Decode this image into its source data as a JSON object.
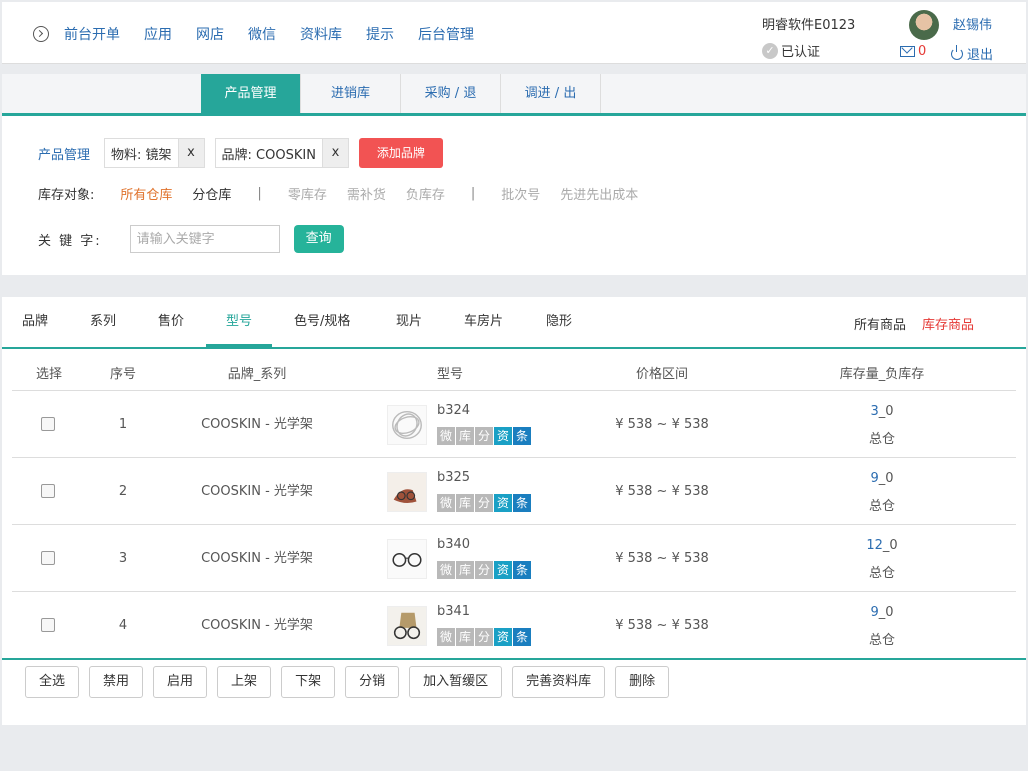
{
  "topbar": {
    "nav": [
      "前台开单",
      "应用",
      "网店",
      "微信",
      "资料库",
      "提示",
      "后台管理"
    ],
    "company": "明睿软件E0123",
    "certified": "已认证",
    "username": "赵锡伟",
    "mail_count": "0",
    "logout": "退出"
  },
  "tabs": [
    "产品管理",
    "进销库",
    "采购 / 退",
    "调进 / 出"
  ],
  "filters": {
    "label": "产品管理",
    "material_chip": "物料:  镜架",
    "brand_chip": "品牌:  COOSKIN",
    "chip_close": "x",
    "add_brand": "添加品牌",
    "stock_target_label": "库存对象:",
    "stock_options": [
      "所有仓库",
      "分仓库"
    ],
    "sep": "|",
    "status_options": [
      "零库存",
      "需补货",
      "负库存"
    ],
    "batch_options": [
      "批次号",
      "先进先出成本"
    ],
    "keyword_label": "关 键 字:",
    "keyword_placeholder": "请输入关键字",
    "query_button": "查询"
  },
  "categories": [
    "品牌",
    "系列",
    "售价",
    "型号",
    "色号/规格",
    "现片",
    "车房片",
    "隐形"
  ],
  "category_active": "型号",
  "view_all": "所有商品",
  "view_stock": "库存商品",
  "table": {
    "headers": [
      "选择",
      "序号",
      "品牌_系列",
      "型号",
      "价格区间",
      "库存量_负库存"
    ],
    "tags": [
      "微",
      "库",
      "分",
      "资",
      "条"
    ],
    "rows": [
      {
        "no": "1",
        "brand": "COOSKIN - 光学架",
        "model": "b324",
        "price": "¥ 538 ~ ¥ 538",
        "stock": "3",
        "neg": "_0",
        "wh": "总仓"
      },
      {
        "no": "2",
        "brand": "COOSKIN - 光学架",
        "model": "b325",
        "price": "¥ 538 ~ ¥ 538",
        "stock": "9",
        "neg": "_0",
        "wh": "总仓"
      },
      {
        "no": "3",
        "brand": "COOSKIN - 光学架",
        "model": "b340",
        "price": "¥ 538 ~ ¥ 538",
        "stock": "12",
        "neg": "_0",
        "wh": "总仓"
      },
      {
        "no": "4",
        "brand": "COOSKIN - 光学架",
        "model": "b341",
        "price": "¥ 538 ~ ¥ 538",
        "stock": "9",
        "neg": "_0",
        "wh": "总仓"
      }
    ]
  },
  "actions": [
    "全选",
    "禁用",
    "启用",
    "上架",
    "下架",
    "分销",
    "加入暂缓区",
    "完善资料库",
    "删除"
  ]
}
